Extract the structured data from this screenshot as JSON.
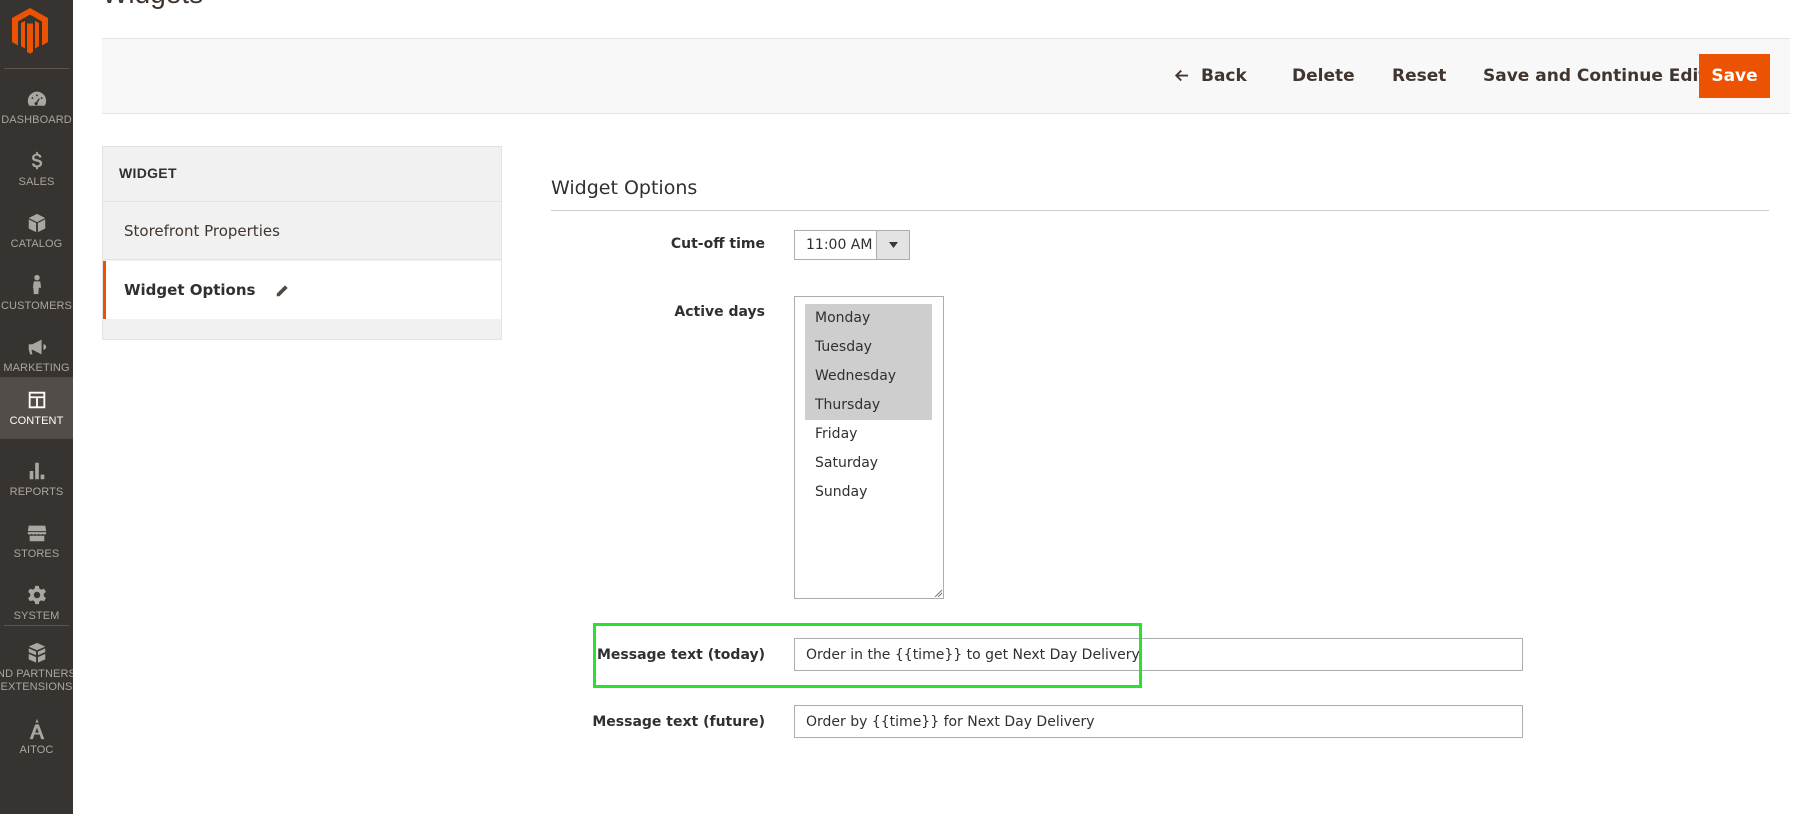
{
  "page": {
    "title": "Widgets"
  },
  "sidebar": {
    "items": [
      {
        "label": "DASHBOARD",
        "icon": "dashboard-icon"
      },
      {
        "label": "SALES",
        "icon": "dollar-icon"
      },
      {
        "label": "CATALOG",
        "icon": "cube-icon"
      },
      {
        "label": "CUSTOMERS",
        "icon": "person-icon"
      },
      {
        "label": "MARKETING",
        "icon": "megaphone-icon"
      },
      {
        "label": "CONTENT",
        "icon": "layout-icon",
        "active": true
      },
      {
        "label": "REPORTS",
        "icon": "bar-chart-icon"
      },
      {
        "label": "STORES",
        "icon": "storefront-icon"
      },
      {
        "label": "SYSTEM",
        "icon": "gear-icon"
      },
      {
        "label": "ND PARTNERS EXTENSIONS",
        "icon": "boxes-icon"
      },
      {
        "label": "AITOC",
        "icon": "aitoc-logo-icon"
      }
    ]
  },
  "toolbar": {
    "back_label": "Back",
    "delete_label": "Delete",
    "reset_label": "Reset",
    "save_continue_label": "Save and Continue Edit",
    "save_label": "Save"
  },
  "tabs": {
    "heading": "WIDGET",
    "items": [
      {
        "label": "Storefront Properties"
      },
      {
        "label": "Widget Options",
        "active": true
      }
    ]
  },
  "form": {
    "section_title": "Widget Options",
    "cutoff_label": "Cut-off time",
    "cutoff_value": "11:00 AM",
    "active_days_label": "Active days",
    "days": [
      {
        "label": "Monday",
        "selected": true
      },
      {
        "label": "Tuesday",
        "selected": true
      },
      {
        "label": "Wednesday",
        "selected": true
      },
      {
        "label": "Thursday",
        "selected": true
      },
      {
        "label": "Friday",
        "selected": false
      },
      {
        "label": "Saturday",
        "selected": false
      },
      {
        "label": "Sunday",
        "selected": false
      }
    ],
    "message_today_label": "Message text (today)",
    "message_today_value": "Order in the {{time}} to get Next Day Delivery",
    "message_future_label": "Message text (future)",
    "message_future_value": "Order by {{time}} for Next Day Delivery"
  },
  "colors": {
    "sidebar_bg": "#373330",
    "accent": "#eb5202",
    "highlight": "#2ee02e"
  }
}
